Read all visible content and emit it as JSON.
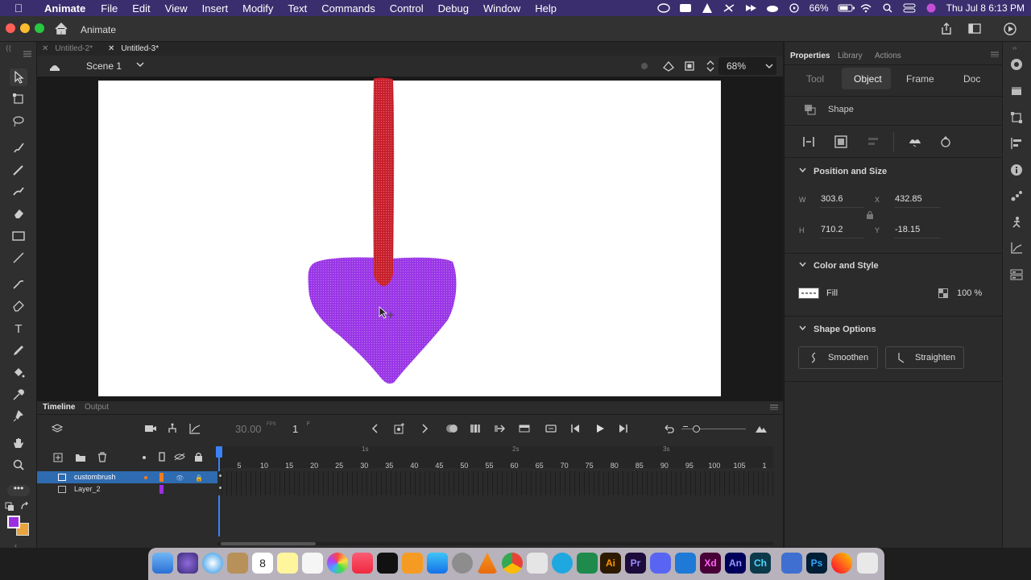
{
  "menubar": {
    "app_name": "Animate",
    "items": [
      "File",
      "Edit",
      "View",
      "Insert",
      "Modify",
      "Text",
      "Commands",
      "Control",
      "Debug",
      "Window",
      "Help"
    ],
    "battery": "66%",
    "clock": "Thu Jul 8  6:13 PM"
  },
  "titlebar": {
    "workspace": "Animate"
  },
  "doc_tabs": [
    {
      "label": "Untitled-2*",
      "active": false
    },
    {
      "label": "Untitled-3*",
      "active": true
    }
  ],
  "scenebar": {
    "scene": "Scene 1",
    "zoom": "68%"
  },
  "timeline": {
    "tabs": [
      "Timeline",
      "Output"
    ],
    "fps_value": "30.00",
    "fps_unit": "FPS",
    "frame": "1",
    "frame_unit": "F",
    "ruler_seconds": [
      "1s",
      "2s",
      "3s"
    ],
    "ruler_numbers": [
      "5",
      "10",
      "15",
      "20",
      "25",
      "30",
      "35",
      "40",
      "45",
      "50",
      "55",
      "60",
      "65",
      "70",
      "75",
      "80",
      "85",
      "90",
      "95",
      "100",
      "105",
      "1"
    ],
    "layers": [
      {
        "name": "custombrush",
        "selected": true,
        "color": "#f07c1f"
      },
      {
        "name": "Layer_2",
        "selected": false,
        "color": "#9b2fe0"
      }
    ]
  },
  "properties": {
    "panel_tabs": [
      "Properties",
      "Library",
      "Actions"
    ],
    "sub_tabs": [
      "Tool",
      "Object",
      "Frame",
      "Doc"
    ],
    "active_sub_tab": "Object",
    "object_type": "Shape",
    "position_size": {
      "title": "Position and Size",
      "w_label": "W",
      "w_value": "303.6",
      "h_label": "H",
      "h_value": "710.2",
      "x_label": "X",
      "x_value": "432.85",
      "y_label": "Y",
      "y_value": "-18.15"
    },
    "color_style": {
      "title": "Color and Style",
      "fill_label": "Fill",
      "alpha": "100 %"
    },
    "shape_options": {
      "title": "Shape Options",
      "smoothen": "Smoothen",
      "straighten": "Straighten"
    }
  },
  "swatches": {
    "stroke": "#9b2fe0",
    "fill": "#e8a33c"
  },
  "colors": {
    "red_shape": "#c8202c",
    "purple_shape": "#9a36e6",
    "accent": "#2f80ed"
  }
}
